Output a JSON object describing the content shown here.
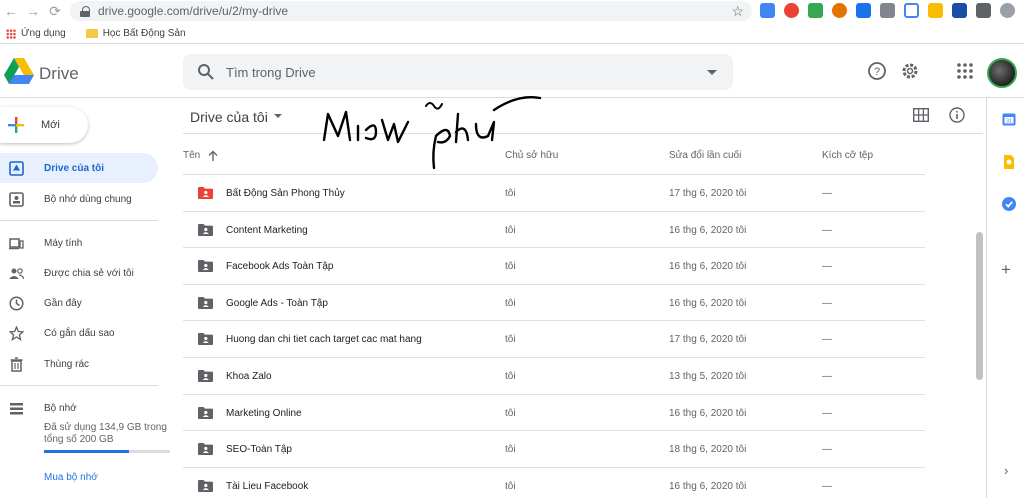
{
  "browser": {
    "url": "drive.google.com/drive/u/2/my-drive",
    "bookmarks": [
      {
        "label": "Ứng dụng"
      },
      {
        "label": "Học Bất Động Sản"
      }
    ]
  },
  "header": {
    "app_name": "Drive",
    "search_placeholder": "Tìm trong Drive"
  },
  "sidebar": {
    "new_label": "Mới",
    "items": [
      {
        "label": "Drive của tôi",
        "icon": "my-drive-icon",
        "active": true
      },
      {
        "label": "Bộ nhớ dùng chung",
        "icon": "shared-drive-icon"
      },
      {
        "label": "Máy tính",
        "icon": "computers-icon"
      },
      {
        "label": "Được chia sẻ với tôi",
        "icon": "shared-with-me-icon"
      },
      {
        "label": "Gần đây",
        "icon": "recent-icon"
      },
      {
        "label": "Có gắn dấu sao",
        "icon": "starred-icon"
      },
      {
        "label": "Thùng rác",
        "icon": "trash-icon"
      }
    ],
    "storage": {
      "label": "Bộ nhớ",
      "usage_line1": "Đã sử dụng 134,9 GB trong",
      "usage_line2": "tổng số 200 GB",
      "used_fraction": 0.6745,
      "buy_label": "Mua bộ nhớ"
    }
  },
  "main": {
    "title": "Drive của tôi",
    "columns": {
      "name": "Tên",
      "owner": "Chủ sở hữu",
      "modified": "Sửa đổi lần cuối",
      "size": "Kích cỡ tệp"
    },
    "files": [
      {
        "name": "Bất Động Sản Phong Thủy",
        "owner": "tôi",
        "modified": "17 thg 6, 2020",
        "modified_by": "tôi",
        "size": "—",
        "color": "#ea4335"
      },
      {
        "name": "Content Marketing",
        "owner": "tôi",
        "modified": "16 thg 6, 2020",
        "modified_by": "tôi",
        "size": "—",
        "color": "#5f6368"
      },
      {
        "name": "Facebook Ads Toàn Tập",
        "owner": "tôi",
        "modified": "16 thg 6, 2020",
        "modified_by": "tôi",
        "size": "—",
        "color": "#5f6368"
      },
      {
        "name": "Google Ads - Toàn Tập",
        "owner": "tôi",
        "modified": "16 thg 6, 2020",
        "modified_by": "tôi",
        "size": "—",
        "color": "#5f6368"
      },
      {
        "name": "Huong dan chi tiet cach target cac mat hang",
        "owner": "tôi",
        "modified": "17 thg 6, 2020",
        "modified_by": "tôi",
        "size": "—",
        "color": "#5f6368"
      },
      {
        "name": "Khoa Zalo",
        "owner": "tôi",
        "modified": "13 thg 5, 2020",
        "modified_by": "tôi",
        "size": "—",
        "color": "#5f6368"
      },
      {
        "name": "Marketing Online",
        "owner": "tôi",
        "modified": "16 thg 6, 2020",
        "modified_by": "tôi",
        "size": "—",
        "color": "#5f6368"
      },
      {
        "name": "SEO-Toàn Tập",
        "owner": "tôi",
        "modified": "18 thg 6, 2020",
        "modified_by": "tôi",
        "size": "—",
        "color": "#5f6368"
      },
      {
        "name": "Tài Lieu Facebook",
        "owner": "tôi",
        "modified": "16 thg 6, 2020",
        "modified_by": "tôi",
        "size": "—",
        "color": "#5f6368"
      }
    ]
  },
  "annotation": {
    "handwritten_text": "Miễn phí"
  }
}
